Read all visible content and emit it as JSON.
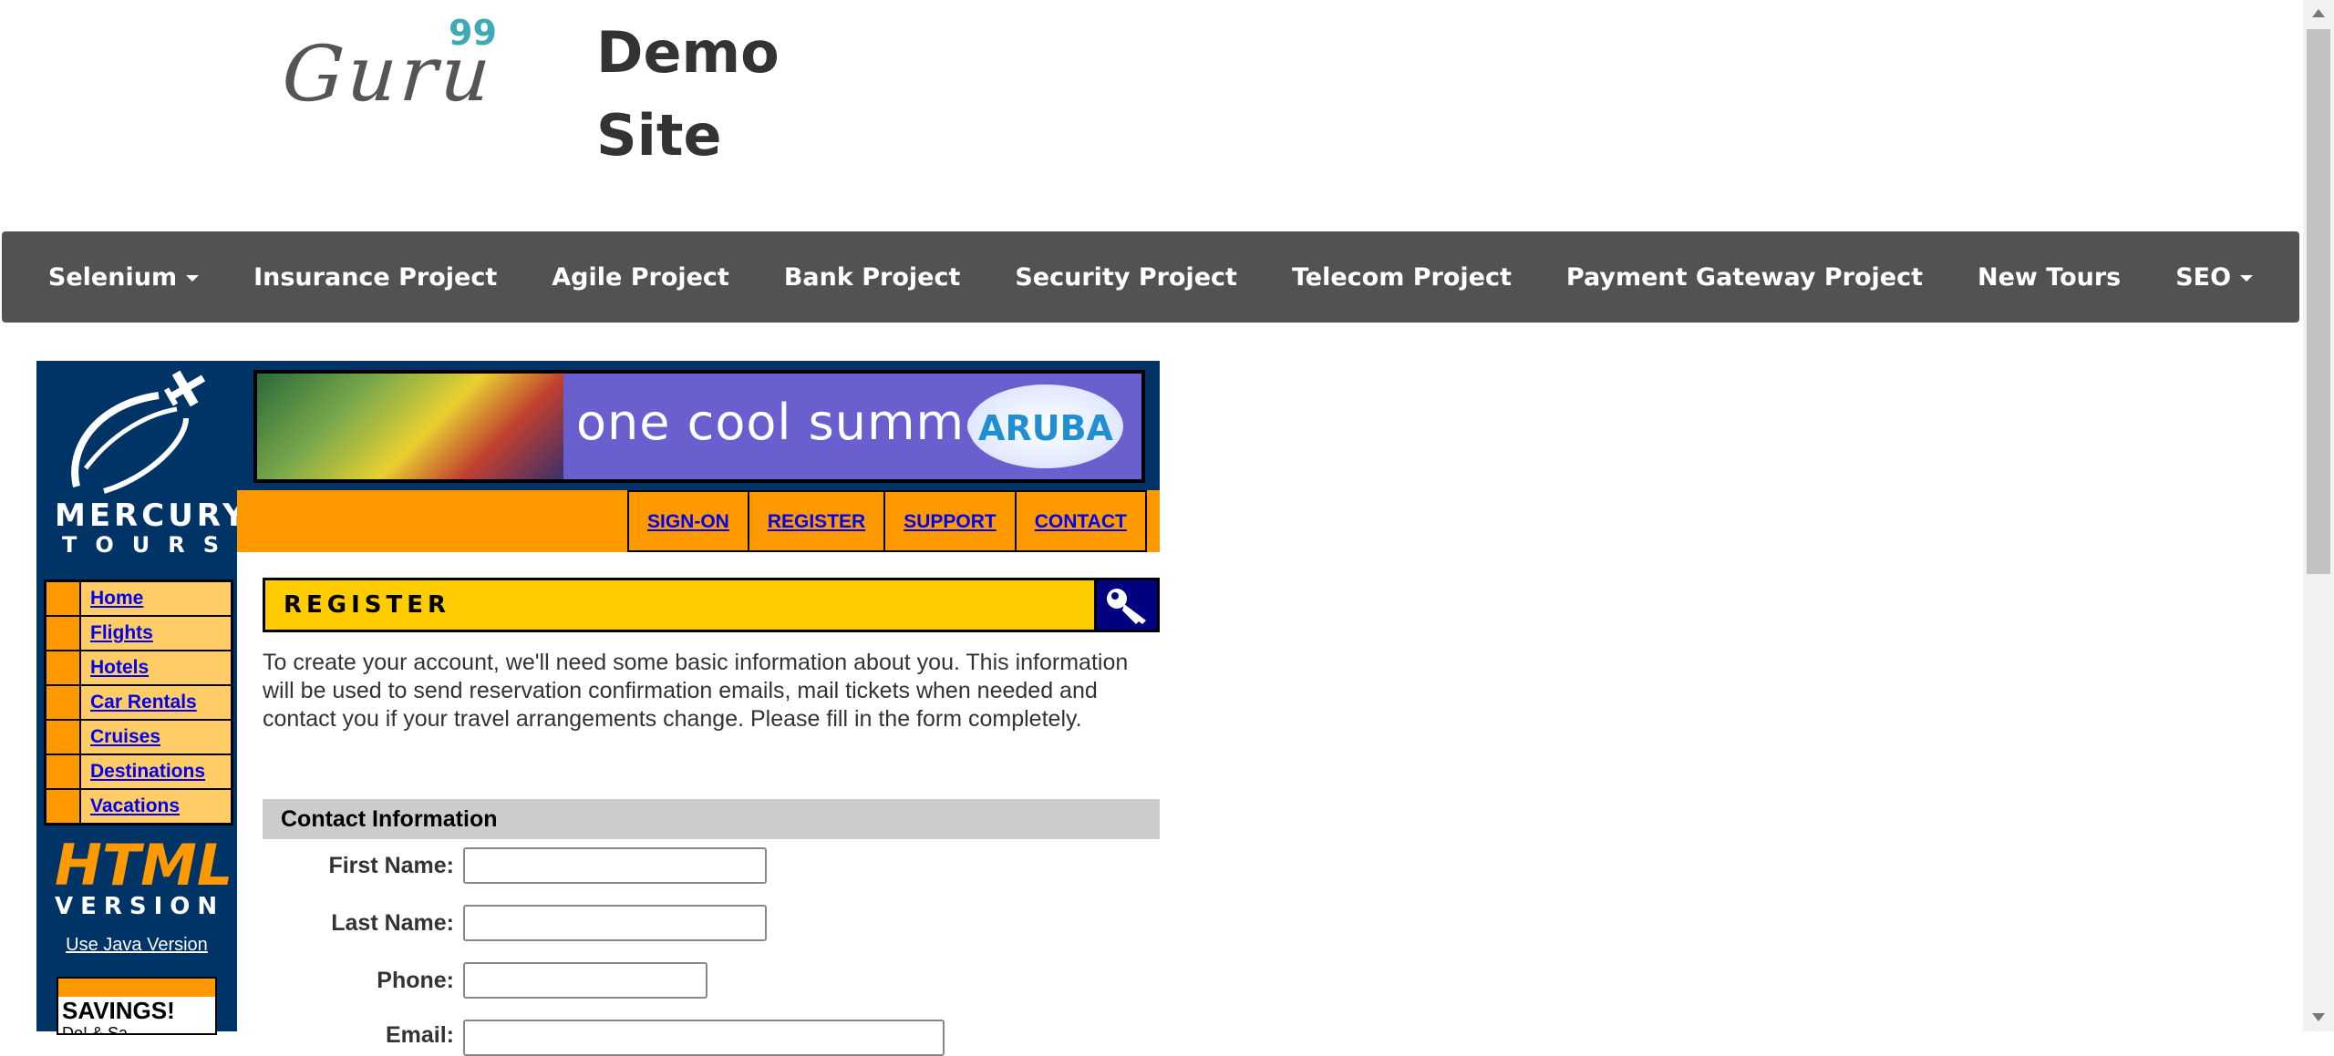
{
  "header": {
    "logo_text": "Guru",
    "logo_sup": "99",
    "title_line1": "Demo",
    "title_line2": "Site"
  },
  "topnav": {
    "items": [
      "Selenium",
      "Insurance Project",
      "Agile Project",
      "Bank Project",
      "Security Project",
      "Telecom Project",
      "Payment Gateway Project",
      "New Tours",
      "SEO"
    ]
  },
  "mercury": {
    "logo_line1": "MERCURY",
    "logo_line2": "TOURS",
    "side_menu": [
      "Home",
      "Flights",
      "Hotels",
      "Car Rentals",
      "Cruises",
      "Destinations",
      "Vacations"
    ],
    "html_badge": "HTML",
    "version_badge": "VERSION",
    "java_link": "Use Java Version",
    "savings_title": "SAVINGS!",
    "savings_sub": "Do! & Sa..."
  },
  "banner": {
    "text": "one cool summer",
    "brand": "ARUBA"
  },
  "top_links": [
    "SIGN-ON",
    "REGISTER",
    "SUPPORT",
    "CONTACT"
  ],
  "register": {
    "title": "REGISTER",
    "intro": "To create your account, we'll need some basic information about you. This information will be used to send reservation confirmation emails, mail tickets when needed and contact you if your travel arrangements change. Please fill in the form completely.",
    "section": "Contact Information",
    "fields": {
      "first_name": {
        "label": "First Name:",
        "value": ""
      },
      "last_name": {
        "label": "Last Name:",
        "value": ""
      },
      "phone": {
        "label": "Phone:",
        "value": ""
      },
      "email": {
        "label": "Email:",
        "value": ""
      }
    }
  },
  "colors": {
    "nav_bg": "#525252",
    "mercury_navy": "#003366",
    "orange": "#ff9900",
    "yellow": "#ffcc00",
    "link_blue": "#0000ee"
  }
}
